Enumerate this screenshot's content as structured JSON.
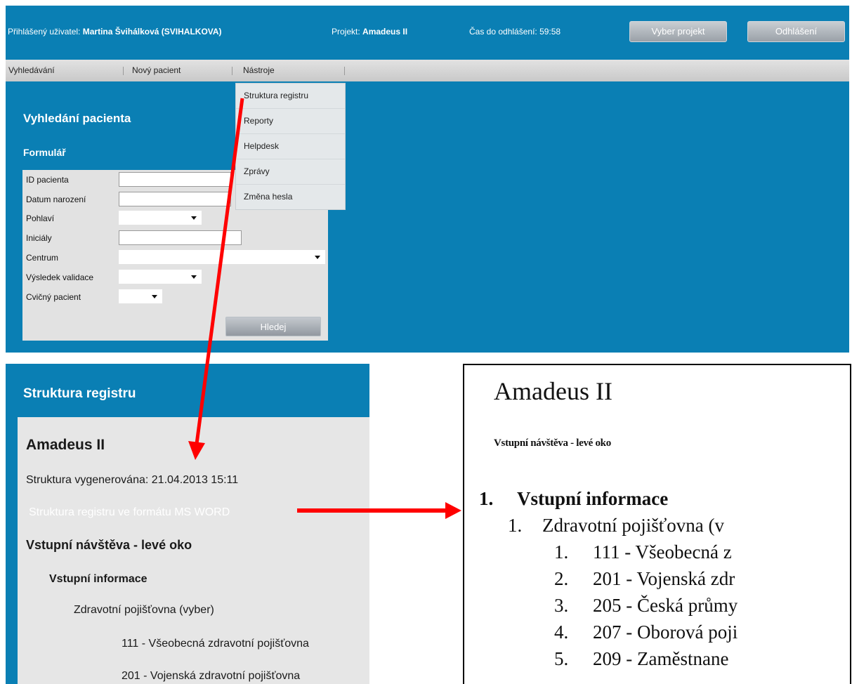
{
  "topbar": {
    "user_label": "Přihlášený uživatel:",
    "user_name": "Martina Švihálková (SVIHALKOVA)",
    "project_label": "Projekt:",
    "project_name": "Amadeus II",
    "timeout_label": "Čas do odhlášení:",
    "timeout_value": "59:58",
    "select_project_button": "Vyber projekt",
    "logout_button": "Odhlášení"
  },
  "menu": {
    "items": [
      "Vyhledávání",
      "Nový pacient",
      "Nástroje"
    ],
    "tools_dropdown": [
      "Struktura registru",
      "Reporty",
      "Helpdesk",
      "Zprávy",
      "Změna hesla"
    ]
  },
  "search": {
    "title": "Vyhledání pacienta",
    "form_title": "Formulář",
    "fields": {
      "patient_id": "ID pacienta",
      "birth_date": "Datum narození",
      "sex": "Pohlaví",
      "initials": "Iniciály",
      "center": "Centrum",
      "validation": "Výsledek validace",
      "training": "Cvičný pacient"
    },
    "search_button": "Hledej"
  },
  "structure": {
    "panel_title": "Struktura registru",
    "project": "Amadeus II",
    "generated": "Struktura vygenerována: 21.04.2013 15:11",
    "word_link": "Struktura registru ve formátu MS WORD",
    "visit": "Vstupní návštěva - levé oko",
    "section": "Vstupní informace",
    "field": "Zdravotní pojišťovna (vyber)",
    "options": [
      "111 - Všeobecná zdravotní pojišťovna",
      "201 - Vojenská zdravotní pojišťovna"
    ]
  },
  "document": {
    "title": "Amadeus II",
    "visit": "Vstupní návštěva - levé oko",
    "section_num": "1.",
    "section": "Vstupní informace",
    "field_num": "1.",
    "field": "Zdravotní pojišťovna (v",
    "items": [
      {
        "num": "1.",
        "text": "111 - Všeobecná z"
      },
      {
        "num": "2.",
        "text": "201 - Vojenská zdr"
      },
      {
        "num": "3.",
        "text": "205 - Česká průmy"
      },
      {
        "num": "4.",
        "text": "207 - Oborová poji"
      },
      {
        "num": "5.",
        "text": "209 - Zaměstnane"
      }
    ]
  },
  "colors": {
    "brand_blue": "#0a7fb4",
    "arrow_red": "#ff0000",
    "panel_gray": "#e6e6e6"
  }
}
